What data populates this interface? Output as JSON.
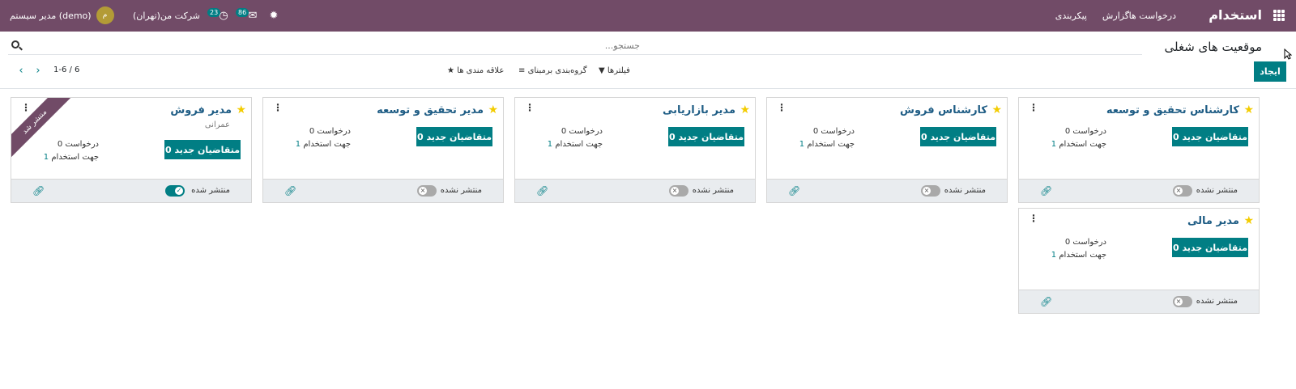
{
  "navbar": {
    "brand": "استخدام",
    "menu": [
      "درخواست ها",
      "گزارش",
      "پیکربندی"
    ],
    "company": "شرکت من(تهران)",
    "user_name": "مدیر سیستم (demo)",
    "avatar_letter": "م",
    "messages_count": "86",
    "activities_count": "23"
  },
  "control_panel": {
    "title": "موقعیت های شغلی",
    "create_label": "ایجاد",
    "search_placeholder": "جستجو...",
    "filters_label": "فیلترها",
    "groupby_label": "گروه‌بندی برمبنای",
    "favorites_label": "علاقه مندی ها",
    "pager_value": "1-6 / 6"
  },
  "cards": [
    {
      "title": "کارشناس تحقیق و توسعه",
      "subtitle": "",
      "new_applicants": "0 متقاضیان جدید",
      "requests_num": "0",
      "requests_label": "درخواست",
      "to_recruit_num": "1",
      "to_recruit_label": "جهت استخدام",
      "status": "منتشر نشده",
      "published": false
    },
    {
      "title": "کارشناس فروش",
      "subtitle": "",
      "new_applicants": "0 متقاضیان جدید",
      "requests_num": "0",
      "requests_label": "درخواست",
      "to_recruit_num": "1",
      "to_recruit_label": "جهت استخدام",
      "status": "منتشر نشده",
      "published": false
    },
    {
      "title": "مدیر بازاریابی",
      "subtitle": "",
      "new_applicants": "0 متقاضیان جدید",
      "requests_num": "0",
      "requests_label": "درخواست",
      "to_recruit_num": "1",
      "to_recruit_label": "جهت استخدام",
      "status": "منتشر نشده",
      "published": false
    },
    {
      "title": "مدیر تحقیق و توسعه",
      "subtitle": "",
      "new_applicants": "0 متقاضیان جدید",
      "requests_num": "0",
      "requests_label": "درخواست",
      "to_recruit_num": "1",
      "to_recruit_label": "جهت استخدام",
      "status": "منتشر نشده",
      "published": false
    },
    {
      "title": "مدیر فروش",
      "subtitle": "عمرانی",
      "new_applicants": "0 متقاضیان جدید",
      "requests_num": "0",
      "requests_label": "درخواست",
      "to_recruit_num": "1",
      "to_recruit_label": "جهت استخدام",
      "status": "منتشر شده",
      "published": true,
      "ribbon": "منتشر شد"
    },
    {
      "title": "مدیر مالی",
      "subtitle": "",
      "new_applicants": "0 متقاضیان جدید",
      "requests_num": "0",
      "requests_label": "درخواست",
      "to_recruit_num": "1",
      "to_recruit_label": "جهت استخدام",
      "status": "منتشر نشده",
      "published": false
    }
  ]
}
